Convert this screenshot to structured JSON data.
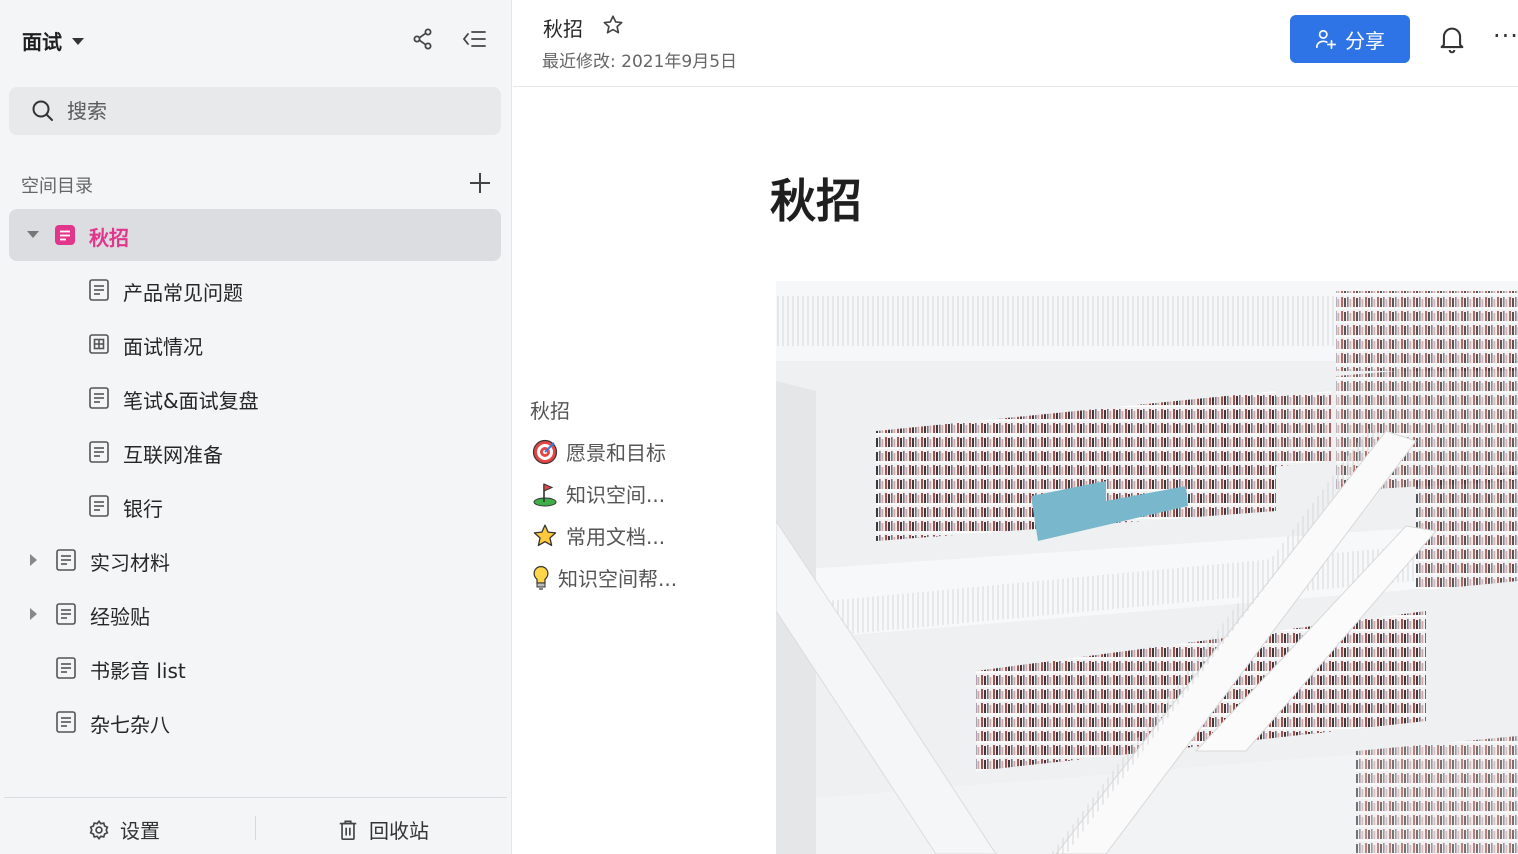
{
  "sidebar": {
    "workspace_title": "面试",
    "search_placeholder": "搜索",
    "directory_label": "空间目录",
    "items": [
      {
        "label": "秋招"
      },
      {
        "label": "产品常见问题"
      },
      {
        "label": "面试情况"
      },
      {
        "label": "笔试&面试复盘"
      },
      {
        "label": "互联网准备"
      },
      {
        "label": "银行"
      },
      {
        "label": "实习材料"
      },
      {
        "label": "经验贴"
      },
      {
        "label": "书影音 list"
      },
      {
        "label": "杂七杂八"
      }
    ],
    "footer": {
      "settings": "设置",
      "trash": "回收站"
    }
  },
  "header": {
    "doc_title": "秋招",
    "last_modified": "最近修改: 2021年9月5日",
    "share_label": "分享",
    "more_label": "···"
  },
  "document": {
    "title": "秋招",
    "toc_heading": "秋招",
    "toc": [
      {
        "label": "愿景和目标",
        "icon": "target-icon"
      },
      {
        "label": "知识空间...",
        "icon": "flag-icon"
      },
      {
        "label": "常用文档...",
        "icon": "star-icon"
      },
      {
        "label": "知识空间帮...",
        "icon": "lightbulb-icon"
      }
    ]
  },
  "colors": {
    "accent": "#2f74e6",
    "active_item": "#e2358c",
    "sidebar_bg": "#f4f5f7"
  }
}
